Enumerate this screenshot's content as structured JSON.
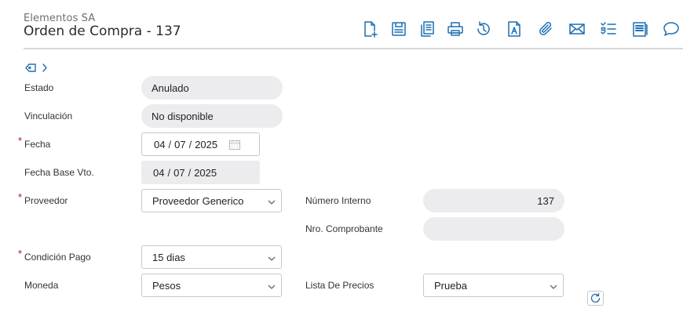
{
  "header": {
    "company": "Elementos SA",
    "title": "Orden de Compra - 137"
  },
  "toolbar": {
    "icons": [
      "new-document-icon",
      "save-icon",
      "copy-icon",
      "print-icon",
      "history-icon",
      "document-a-icon",
      "attach-icon",
      "mail-icon",
      "checklist-icon",
      "notes-icon",
      "comment-icon"
    ]
  },
  "form": {
    "estado": {
      "label": "Estado",
      "value": "Anulado"
    },
    "vinculacion": {
      "label": "Vinculación",
      "value": "No disponible"
    },
    "fecha": {
      "label": "Fecha",
      "required": "*",
      "day": "04",
      "month": "07",
      "year": "2025"
    },
    "fecha_base": {
      "label": "Fecha Base Vto.",
      "day": "04",
      "month": "07",
      "year": "2025"
    },
    "proveedor": {
      "label": "Proveedor",
      "required": "*",
      "value": "Proveedor Generico"
    },
    "numero_interno": {
      "label": "Número Interno",
      "value": "137"
    },
    "nro_comprobante": {
      "label": "Nro. Comprobante",
      "value": ""
    },
    "condicion_pago": {
      "label": "Condición Pago",
      "required": "*",
      "value": "15 dias"
    },
    "moneda": {
      "label": "Moneda",
      "value": "Pesos"
    },
    "lista_precios": {
      "label": "Lista De Precios",
      "value": "Prueba"
    }
  },
  "colors": {
    "accent": "#1f6fb2",
    "required": "#d0021b",
    "readonly_bg": "#ececef"
  }
}
